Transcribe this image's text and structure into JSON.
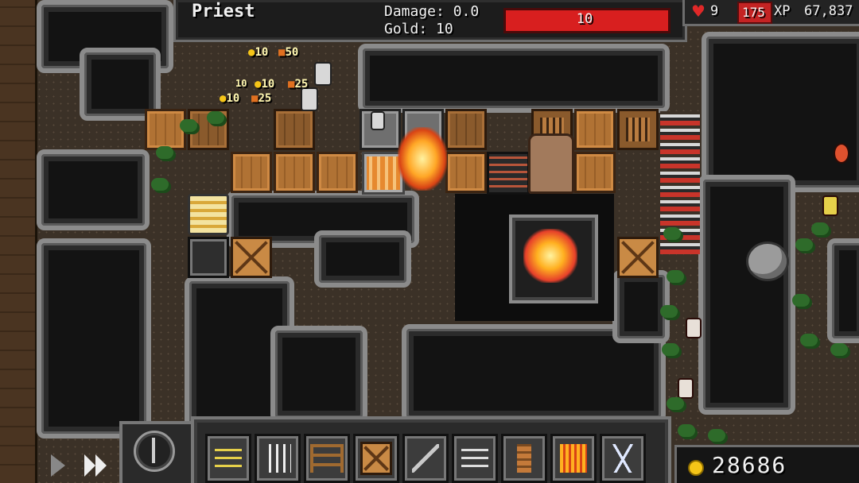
{
  "target": {
    "name": "Priest",
    "damage_label": "Damage: 0.0",
    "gold_label": "Gold: 10",
    "health_value": "10"
  },
  "player": {
    "lives": "9",
    "level": "175",
    "xp_label": "XP",
    "xp_value": "67,837",
    "gold": "28686"
  },
  "floating_text": [
    {
      "text": "10"
    },
    {
      "text": "50"
    },
    {
      "text": "10"
    },
    {
      "text": "25"
    },
    {
      "text": "10"
    },
    {
      "text": "25"
    },
    {
      "text": "10"
    }
  ],
  "toolbar": {
    "items": [
      {
        "icon": "arrow-trap-icon"
      },
      {
        "icon": "spike-trap-icon"
      },
      {
        "icon": "ladder-trap-icon"
      },
      {
        "icon": "barricade-icon"
      },
      {
        "icon": "lever-trap-icon"
      },
      {
        "icon": "dart-trap-icon"
      },
      {
        "icon": "totem-trap-icon"
      },
      {
        "icon": "fire-trap-icon"
      },
      {
        "icon": "lightning-trap-icon"
      }
    ]
  },
  "colors": {
    "health_bar": "#d81f1f",
    "level_badge": "#c42323",
    "heart": "#e02828",
    "coin": "#f5c518"
  }
}
